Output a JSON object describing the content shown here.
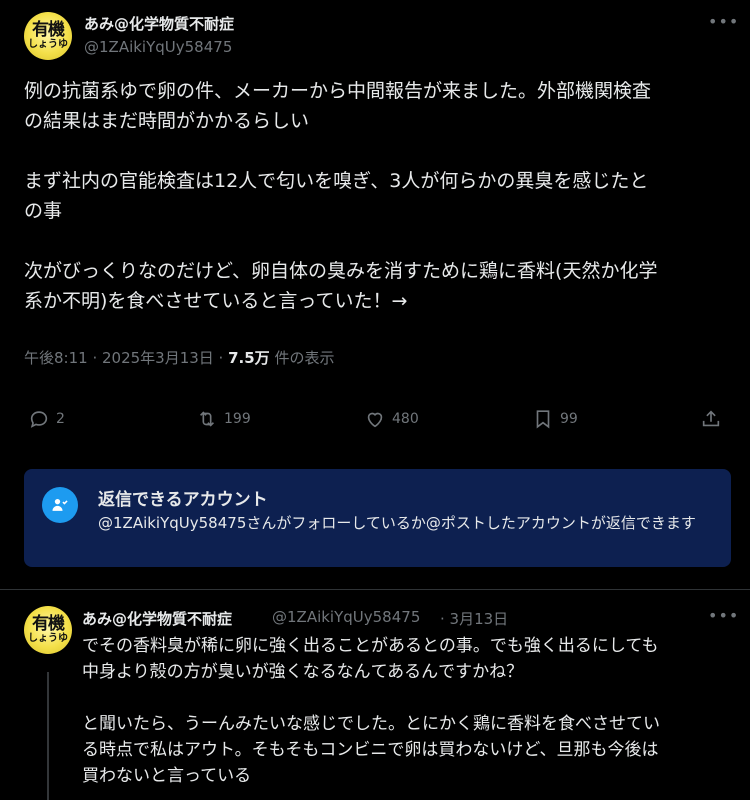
{
  "post": {
    "author_name": "あみ@化学物質不耐症",
    "author_handle": "@1ZAikiYqUy58475",
    "avatar_text_top": "有機",
    "avatar_text_bottom": "しょうゆ",
    "text_lines": [
      "例の抗菌系ゆで卵の件、メーカーから中間報告が来ました。外部機関検査",
      "の結果はまだ時間がかかるらしい",
      "",
      "まず社内の官能検査は12人で匂いを嗅ぎ、3人が何らかの異臭を感じたと",
      "の事",
      "",
      "次がびっくりなのだけど、卵自体の臭みを消すために鶏に香料(天然か化学",
      "系か不明)を食べさせていると言っていた！→"
    ],
    "timestamp": "午後8:11 · 2025年3月13日 · ",
    "views_count": "7.5万",
    "views_label": " 件の表示",
    "stats": {
      "replies": "2",
      "reposts": "199",
      "likes": "480",
      "bookmarks": "99"
    }
  },
  "reply_restriction": {
    "title": "返信できるアカウント",
    "description": "@1ZAikiYqUy58475さんがフォローしているか@ポストしたアカウントが返信できます"
  },
  "reply": {
    "author_name": "あみ@化学物質不耐症",
    "author_handle": "@1ZAikiYqUy58475",
    "date": "· 3月13日",
    "avatar_text_top": "有機",
    "avatar_text_bottom": "しょうゆ",
    "text_lines": [
      "でその香料臭が稀に卵に強く出ることがあるとの事。でも強く出るにしても",
      "中身より殻の方が臭いが強くなるなんてあるんですかね？",
      "",
      "と聞いたら、うーんみたいな感じでした。とにかく鶏に香料を食べさせてい",
      "る時点で私はアウト。そもそもコンビニで卵は買わないけど、旦那も今後は",
      "買わないと言っている"
    ]
  },
  "icons": {
    "more": "more-horizontal-icon",
    "reply": "reply-icon",
    "repost": "repost-icon",
    "like": "heart-icon",
    "bookmark": "bookmark-icon",
    "share": "share-icon",
    "restriction": "people-icon"
  },
  "colors": {
    "background": "#000000",
    "text": "#e7e9ea",
    "muted": "#71767b",
    "accent": "#1d9bf0",
    "banner": "#0d2050"
  }
}
